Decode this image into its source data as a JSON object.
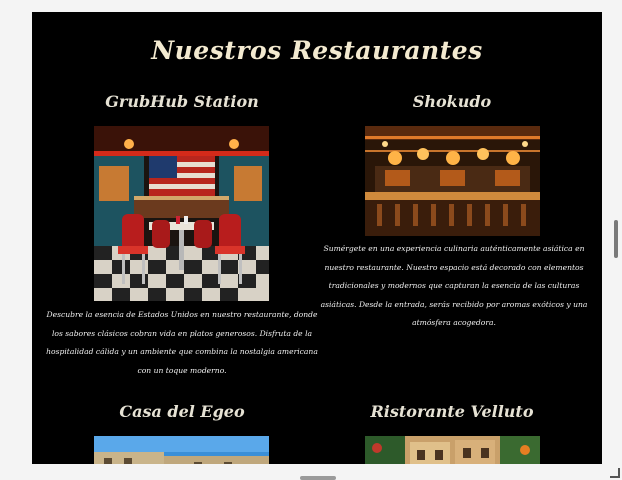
{
  "section": {
    "title": "Nuestros Restaurantes"
  },
  "restaurants": [
    {
      "name": "GrubHub Station",
      "description_lines": [
        "Descubre la esencia de Estados Unidos en nuestro restaurante, donde",
        "los sabores clásicos cobran vida en platos generosos. Disfruta de la",
        "hospitalidad cálida y un ambiente que combina la nostalgia americana",
        "con un toque moderno."
      ]
    },
    {
      "name": "Shokudo",
      "description_lines": [
        "Sumérgete en una experiencia culinaria auténticamente asiática en",
        "nuestro restaurante. Nuestro espacio está decorado con elementos",
        "tradicionales y modernos que capturan la esencia de las culturas",
        "asiáticas. Desde la entrada, serás recibido por aromas exóticos y una",
        "atmósfera acogedora."
      ]
    },
    {
      "name": "Casa del Egeo"
    },
    {
      "name": "Ristorante Velluto"
    }
  ]
}
